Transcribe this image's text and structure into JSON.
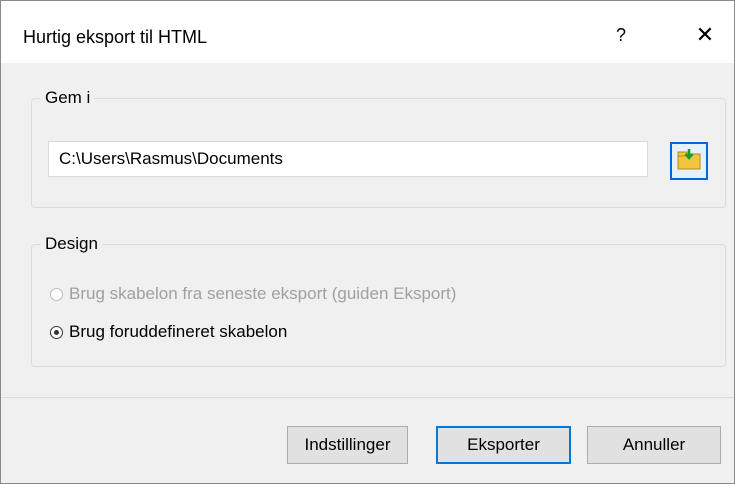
{
  "dialog": {
    "title": "Hurtig eksport til HTML",
    "help_label": "?",
    "close_label": "✕"
  },
  "save_group": {
    "label": "Gem i",
    "path_value": "C:\\Users\\Rasmus\\Documents",
    "browse_icon": "folder-icon"
  },
  "design_group": {
    "label": "Design",
    "options": [
      {
        "label": "Brug skabelon fra seneste eksport (guiden Eksport)",
        "checked": false,
        "disabled": true
      },
      {
        "label": "Brug foruddefineret skabelon",
        "checked": true,
        "disabled": false
      }
    ]
  },
  "buttons": {
    "settings": "Indstillinger",
    "export": "Eksporter",
    "cancel": "Annuller"
  },
  "colors": {
    "accent": "#0078d7",
    "dialog_bg": "#f0f0f0",
    "titlebar_bg": "#ffffff"
  }
}
